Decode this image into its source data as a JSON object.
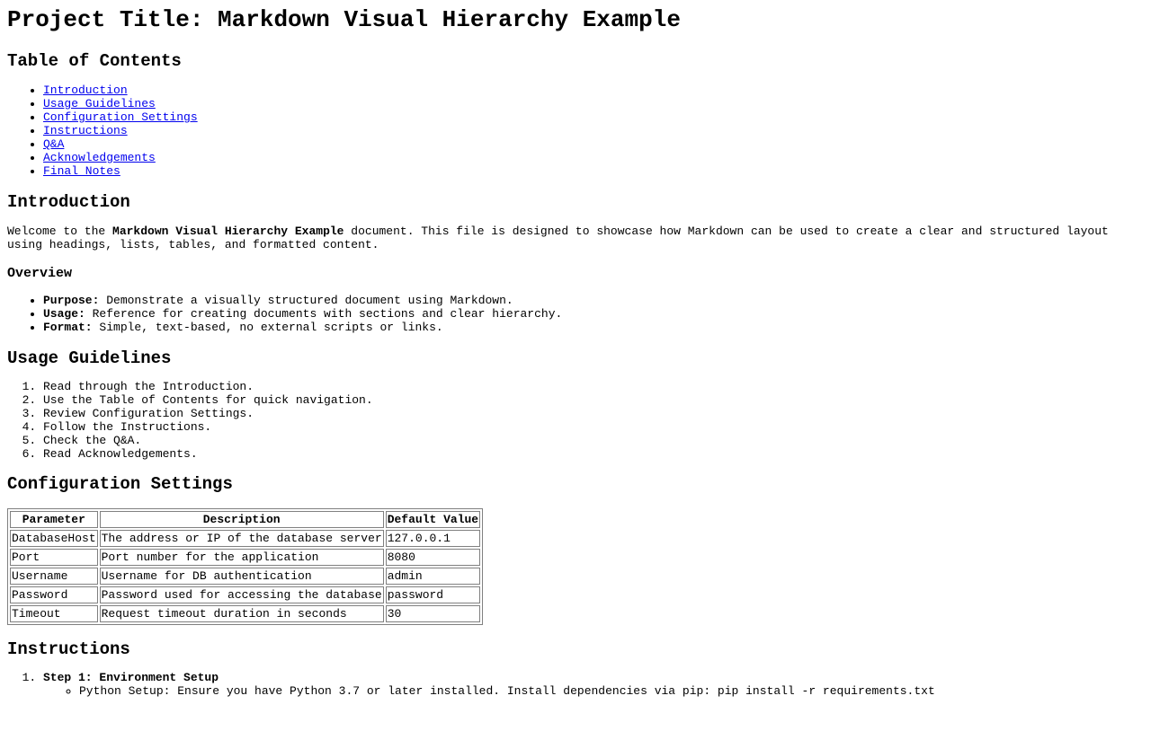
{
  "title": "Project Title: Markdown Visual Hierarchy Example",
  "toc": {
    "heading": "Table of Contents",
    "items": [
      "Introduction",
      "Usage Guidelines",
      "Configuration Settings",
      "Instructions",
      "Q&A",
      "Acknowledgements",
      "Final Notes"
    ]
  },
  "intro": {
    "heading": "Introduction",
    "text_before": "Welcome to the ",
    "text_bold": "Markdown Visual Hierarchy Example",
    "text_after": " document. This file is designed to showcase how Markdown can be used to create a clear and structured layout using headings, lists, tables, and formatted content.",
    "overview_heading": "Overview",
    "overview_items": [
      {
        "label": "Purpose:",
        "text": " Demonstrate a visually structured document using Markdown."
      },
      {
        "label": "Usage:",
        "text": " Reference for creating documents with sections and clear hierarchy."
      },
      {
        "label": "Format:",
        "text": " Simple, text-based, no external scripts or links."
      }
    ]
  },
  "usage": {
    "heading": "Usage Guidelines",
    "items": [
      "Read through the Introduction.",
      "Use the Table of Contents for quick navigation.",
      "Review Configuration Settings.",
      "Follow the Instructions.",
      "Check the Q&A.",
      "Read Acknowledgements."
    ]
  },
  "config": {
    "heading": "Configuration Settings",
    "columns": [
      "Parameter",
      "Description",
      "Default Value"
    ],
    "rows": [
      [
        "DatabaseHost",
        "The address or IP of the database server",
        "127.0.0.1"
      ],
      [
        "Port",
        "Port number for the application",
        "8080"
      ],
      [
        "Username",
        "Username for DB authentication",
        "admin"
      ],
      [
        "Password",
        "Password used for accessing the database",
        "password"
      ],
      [
        "Timeout",
        "Request timeout duration in seconds",
        "30"
      ]
    ]
  },
  "instructions": {
    "heading": "Instructions",
    "steps": [
      {
        "title": "Step 1: Environment Setup",
        "subitems": [
          "Python Setup: Ensure you have Python 3.7 or later installed. Install dependencies via pip: pip install -r requirements.txt"
        ]
      }
    ]
  }
}
